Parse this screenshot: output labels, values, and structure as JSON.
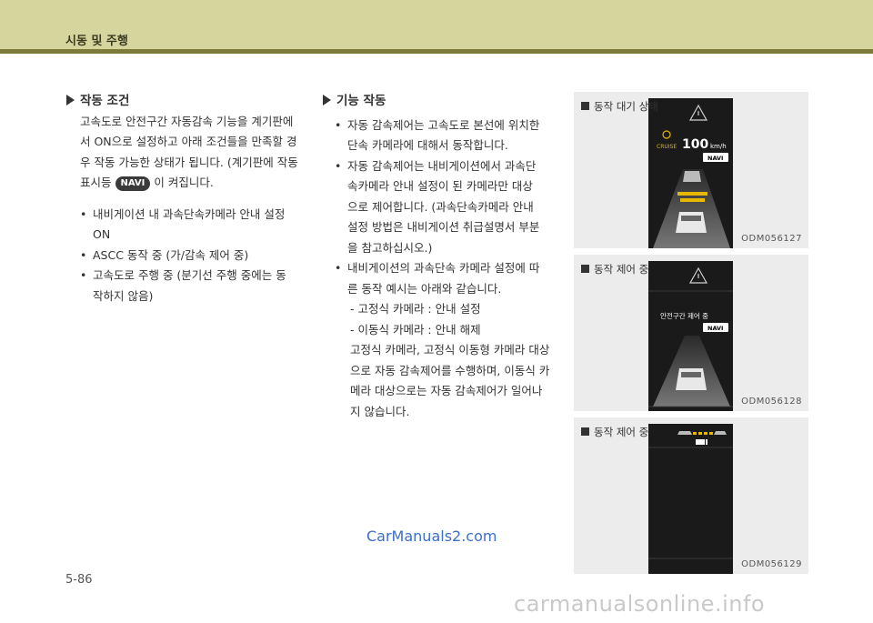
{
  "header": {
    "title": "시동 및 주행"
  },
  "left": {
    "heading": "작동 조건",
    "para_lines": [
      "고속도로 안전구간 자동감속 기능을 계기판에",
      "서 ON으로 설정하고 아래 조건들을 만족할 경",
      "우 작동 가능한 상태가 됩니다. (계기판에 작동"
    ],
    "para_last_prefix": "표시등",
    "badge": "NAVI",
    "para_last_suffix": "이 켜집니다.",
    "bullets": [
      [
        "내비게이션 내 과속단속카메라 안내 설정",
        "ON"
      ],
      [
        "ASCC 동작 중 (가/감속 제어 중)"
      ],
      [
        "고속도로 주행 중 (분기선 주행 중에는 동",
        "작하지 않음)"
      ]
    ]
  },
  "right": {
    "heading": "기능 작동",
    "bullets": [
      [
        "자동 감속제어는 고속도로 본선에 위치한",
        "단속 카메라에 대해서 동작합니다."
      ],
      [
        "자동 감속제어는 내비게이션에서 과속단",
        "속카메라 안내 설정이 된 카메라만 대상",
        "으로 제어합니다. (과속단속카메라 안내",
        "설정 방법은 내비게이션 취급설명서 부분",
        "을 참고하십시오.)"
      ],
      [
        "내비게이션의 과속단속 카메라 설정에 따",
        "른 동작 예시는 아래와 같습니다."
      ]
    ],
    "sub_lines": [
      "- 고정식 카메라 : 안내 설정",
      "- 이동식 카메라 : 안내 해제",
      "고정식 카메라, 고정식 이동형 카메라 대상",
      "으로 자동 감속제어를 수행하며, 이동식 카",
      "메라 대상으로는 자동 감속제어가 일어나",
      "지 않습니다."
    ]
  },
  "panels": [
    {
      "label": "동작 대기 상태",
      "code": "ODM056127",
      "cruise": "CRUISE",
      "speed": "100",
      "unit": "km/h",
      "navi": "NAVI"
    },
    {
      "label": "동작 제어 중",
      "code": "ODM056128",
      "text": "안전구간 제어 중",
      "navi": "NAVI"
    },
    {
      "label": "동작 제어 중",
      "code": "ODM056129"
    }
  ],
  "watermark": "CarManuals2.com",
  "page_number": "5-86",
  "footer_watermark": "carmanualsonline.info",
  "colors": {
    "header_bg": "#d7d59e",
    "header_rule": "#7d7a3a",
    "panel_bg": "#ececec",
    "cruise_yellow": "#e6b800",
    "watermark_blue": "#3d6ec9"
  }
}
